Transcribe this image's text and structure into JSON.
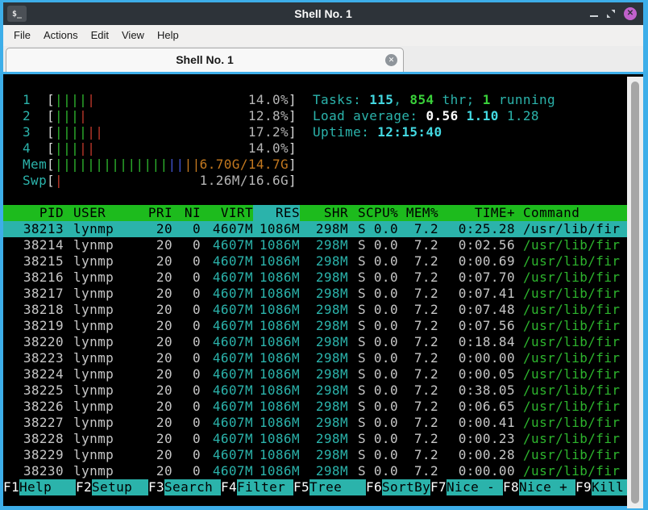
{
  "colors": {
    "accent_border": "#3daee9",
    "titlebar_bg": "#2d3339",
    "terminal_bg": "#000000",
    "teal": "#2bb3ab",
    "header_green": "#1dbb1d",
    "bar_green": "#2db52d",
    "cmd_green": "#2db52d",
    "bright_green": "#3ad13a",
    "bright_cyan": "#43d8e1",
    "text_gray": "#c7c7c7",
    "dim_gray": "#b5b5b5",
    "white": "#ffffff",
    "red": "#c0392b",
    "blue": "#4053cf",
    "orange": "#c4791f",
    "close_btn": "#c061cb"
  },
  "window": {
    "title": "Shell No. 1",
    "icon_text": "$_",
    "close_glyph": "✕"
  },
  "menu": {
    "items": [
      "File",
      "Actions",
      "Edit",
      "View",
      "Help"
    ]
  },
  "tab": {
    "label": "Shell No. 1",
    "close_glyph": "✕"
  },
  "htop": {
    "meters": {
      "open": "[",
      "close": "]",
      "cpus": [
        {
          "label": "1",
          "value": "14.0%",
          "bars": [
            {
              "color": "green",
              "count": 4
            },
            {
              "color": "red",
              "count": 1
            }
          ]
        },
        {
          "label": "2",
          "value": "12.8%",
          "bars": [
            {
              "color": "green",
              "count": 3
            },
            {
              "color": "red",
              "count": 1
            }
          ]
        },
        {
          "label": "3",
          "value": "17.2%",
          "bars": [
            {
              "color": "green",
              "count": 4
            },
            {
              "color": "red",
              "count": 2
            }
          ]
        },
        {
          "label": "4",
          "value": "14.0%",
          "bars": [
            {
              "color": "green",
              "count": 3
            },
            {
              "color": "red",
              "count": 2
            }
          ]
        }
      ],
      "mem": {
        "label": "Mem",
        "value": "6.70G/14.7G",
        "value_style": "orange",
        "bars": [
          {
            "color": "green",
            "count": 14
          },
          {
            "color": "blue",
            "count": 2
          },
          {
            "color": "orange",
            "count": 2
          }
        ]
      },
      "swp": {
        "label": "Swp",
        "value": "1.26M/16.6G",
        "value_style": "gray",
        "bars": [
          {
            "color": "red",
            "count": 1
          }
        ]
      }
    },
    "info_lines": [
      {
        "name": "tasks-summary",
        "segments": [
          {
            "text": "Tasks: ",
            "style": "teal"
          },
          {
            "text": "115",
            "style": "cyanb"
          },
          {
            "text": ", ",
            "style": "teal"
          },
          {
            "text": "854",
            "style": "greenb"
          },
          {
            "text": " thr; ",
            "style": "teal"
          },
          {
            "text": "1",
            "style": "greenb"
          },
          {
            "text": " running",
            "style": "teal"
          }
        ]
      },
      {
        "name": "load-average",
        "segments": [
          {
            "text": "Load average: ",
            "style": "teal"
          },
          {
            "text": "0.56 ",
            "style": "whiteb"
          },
          {
            "text": "1.10 ",
            "style": "cyanb"
          },
          {
            "text": "1.28",
            "style": "teal"
          }
        ]
      },
      {
        "name": "uptime",
        "segments": [
          {
            "text": "Uptime: ",
            "style": "teal"
          },
          {
            "text": "12:15:40",
            "style": "cyanb"
          }
        ]
      }
    ],
    "columns": [
      {
        "key": "pid",
        "label": "PID"
      },
      {
        "key": "user",
        "label": "USER"
      },
      {
        "key": "pri",
        "label": "PRI"
      },
      {
        "key": "ni",
        "label": "NI"
      },
      {
        "key": "virt",
        "label": "VIRT"
      },
      {
        "key": "res",
        "label": "RES",
        "sorted": true
      },
      {
        "key": "shr",
        "label": "SHR"
      },
      {
        "key": "s",
        "label": "S"
      },
      {
        "key": "cpu",
        "label": "CPU%"
      },
      {
        "key": "mem",
        "label": "MEM%"
      },
      {
        "key": "time",
        "label": "TIME+"
      },
      {
        "key": "cmd",
        "label": "Command"
      }
    ],
    "rows": [
      {
        "pid": "38213",
        "user": "lynmp",
        "pri": "20",
        "ni": "0",
        "virt": "4607M",
        "res": "1086M",
        "shr": "298M",
        "s": "S",
        "cpu": "0.0",
        "mem": "7.2",
        "time": "0:25.28",
        "cmd": "/usr/lib/fir",
        "selected": true
      },
      {
        "pid": "38214",
        "user": "lynmp",
        "pri": "20",
        "ni": "0",
        "virt": "4607M",
        "res": "1086M",
        "shr": "298M",
        "s": "S",
        "cpu": "0.0",
        "mem": "7.2",
        "time": "0:02.56",
        "cmd": "/usr/lib/fir"
      },
      {
        "pid": "38215",
        "user": "lynmp",
        "pri": "20",
        "ni": "0",
        "virt": "4607M",
        "res": "1086M",
        "shr": "298M",
        "s": "S",
        "cpu": "0.0",
        "mem": "7.2",
        "time": "0:00.69",
        "cmd": "/usr/lib/fir"
      },
      {
        "pid": "38216",
        "user": "lynmp",
        "pri": "20",
        "ni": "0",
        "virt": "4607M",
        "res": "1086M",
        "shr": "298M",
        "s": "S",
        "cpu": "0.0",
        "mem": "7.2",
        "time": "0:07.70",
        "cmd": "/usr/lib/fir"
      },
      {
        "pid": "38217",
        "user": "lynmp",
        "pri": "20",
        "ni": "0",
        "virt": "4607M",
        "res": "1086M",
        "shr": "298M",
        "s": "S",
        "cpu": "0.0",
        "mem": "7.2",
        "time": "0:07.41",
        "cmd": "/usr/lib/fir"
      },
      {
        "pid": "38218",
        "user": "lynmp",
        "pri": "20",
        "ni": "0",
        "virt": "4607M",
        "res": "1086M",
        "shr": "298M",
        "s": "S",
        "cpu": "0.0",
        "mem": "7.2",
        "time": "0:07.48",
        "cmd": "/usr/lib/fir"
      },
      {
        "pid": "38219",
        "user": "lynmp",
        "pri": "20",
        "ni": "0",
        "virt": "4607M",
        "res": "1086M",
        "shr": "298M",
        "s": "S",
        "cpu": "0.0",
        "mem": "7.2",
        "time": "0:07.56",
        "cmd": "/usr/lib/fir"
      },
      {
        "pid": "38220",
        "user": "lynmp",
        "pri": "20",
        "ni": "0",
        "virt": "4607M",
        "res": "1086M",
        "shr": "298M",
        "s": "S",
        "cpu": "0.0",
        "mem": "7.2",
        "time": "0:18.84",
        "cmd": "/usr/lib/fir"
      },
      {
        "pid": "38223",
        "user": "lynmp",
        "pri": "20",
        "ni": "0",
        "virt": "4607M",
        "res": "1086M",
        "shr": "298M",
        "s": "S",
        "cpu": "0.0",
        "mem": "7.2",
        "time": "0:00.00",
        "cmd": "/usr/lib/fir"
      },
      {
        "pid": "38224",
        "user": "lynmp",
        "pri": "20",
        "ni": "0",
        "virt": "4607M",
        "res": "1086M",
        "shr": "298M",
        "s": "S",
        "cpu": "0.0",
        "mem": "7.2",
        "time": "0:00.05",
        "cmd": "/usr/lib/fir"
      },
      {
        "pid": "38225",
        "user": "lynmp",
        "pri": "20",
        "ni": "0",
        "virt": "4607M",
        "res": "1086M",
        "shr": "298M",
        "s": "S",
        "cpu": "0.0",
        "mem": "7.2",
        "time": "0:38.05",
        "cmd": "/usr/lib/fir"
      },
      {
        "pid": "38226",
        "user": "lynmp",
        "pri": "20",
        "ni": "0",
        "virt": "4607M",
        "res": "1086M",
        "shr": "298M",
        "s": "S",
        "cpu": "0.0",
        "mem": "7.2",
        "time": "0:06.65",
        "cmd": "/usr/lib/fir"
      },
      {
        "pid": "38227",
        "user": "lynmp",
        "pri": "20",
        "ni": "0",
        "virt": "4607M",
        "res": "1086M",
        "shr": "298M",
        "s": "S",
        "cpu": "0.0",
        "mem": "7.2",
        "time": "0:00.41",
        "cmd": "/usr/lib/fir"
      },
      {
        "pid": "38228",
        "user": "lynmp",
        "pri": "20",
        "ni": "0",
        "virt": "4607M",
        "res": "1086M",
        "shr": "298M",
        "s": "S",
        "cpu": "0.0",
        "mem": "7.2",
        "time": "0:00.23",
        "cmd": "/usr/lib/fir"
      },
      {
        "pid": "38229",
        "user": "lynmp",
        "pri": "20",
        "ni": "0",
        "virt": "4607M",
        "res": "1086M",
        "shr": "298M",
        "s": "S",
        "cpu": "0.0",
        "mem": "7.2",
        "time": "0:00.28",
        "cmd": "/usr/lib/fir"
      },
      {
        "pid": "38230",
        "user": "lynmp",
        "pri": "20",
        "ni": "0",
        "virt": "4607M",
        "res": "1086M",
        "shr": "298M",
        "s": "S",
        "cpu": "0.0",
        "mem": "7.2",
        "time": "0:00.00",
        "cmd": "/usr/lib/fir"
      }
    ],
    "fkeys": [
      {
        "key": "F1",
        "label": "Help"
      },
      {
        "key": "F2",
        "label": "Setup"
      },
      {
        "key": "F3",
        "label": "Search"
      },
      {
        "key": "F4",
        "label": "Filter"
      },
      {
        "key": "F5",
        "label": "Tree"
      },
      {
        "key": "F6",
        "label": "SortBy"
      },
      {
        "key": "F7",
        "label": "Nice -"
      },
      {
        "key": "F8",
        "label": "Nice +"
      },
      {
        "key": "F9",
        "label": "Kill"
      }
    ]
  }
}
